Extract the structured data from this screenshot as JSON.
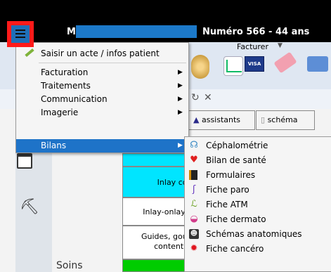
{
  "window": {
    "title_left": "M",
    "title_right": "Numéro 566   -   44 ans"
  },
  "toolbar": {
    "facturer_label": "Facturer",
    "visa_label": "VISA"
  },
  "tabs": [
    {
      "label": "assistants"
    },
    {
      "label": "schéma"
    }
  ],
  "grid": {
    "cells": [
      {
        "label": "Inlay cor"
      },
      {
        "label": "Inlay-onlay /"
      },
      {
        "label": "Guides, gout"
      },
      {
        "label": "contentio"
      }
    ],
    "soins_label": "Soins"
  },
  "main_menu": {
    "items": [
      {
        "label": "Saisir un acte / infos patient",
        "has_submenu": false
      },
      {
        "label": "Facturation",
        "has_submenu": true
      },
      {
        "label": "Traitements",
        "has_submenu": true
      },
      {
        "label": "Communication",
        "has_submenu": true
      },
      {
        "label": "Imagerie",
        "has_submenu": true
      },
      {
        "label": "Bilans",
        "has_submenu": true,
        "active": true
      }
    ]
  },
  "submenu": {
    "items": [
      {
        "label": "Céphalométrie",
        "icon": "tooth-icon"
      },
      {
        "label": "Bilan de santé",
        "icon": "heart-icon"
      },
      {
        "label": "Formulaires",
        "icon": "form-icon"
      },
      {
        "label": "Fiche paro",
        "icon": "paro-icon"
      },
      {
        "label": "Fiche ATM",
        "icon": "jaw-icon"
      },
      {
        "label": "Fiche dermato",
        "icon": "lips-icon"
      },
      {
        "label": "Schémas anatomiques",
        "icon": "skull-icon"
      },
      {
        "label": "Fiche cancéro",
        "icon": "virus-icon"
      }
    ]
  },
  "colors": {
    "title_highlight": "#1c79c9",
    "menu_active": "#1e73c8",
    "annotation_red": "#ff1a1a",
    "cyan_cells": "#00e5ff",
    "green_cell": "#00cc00"
  }
}
